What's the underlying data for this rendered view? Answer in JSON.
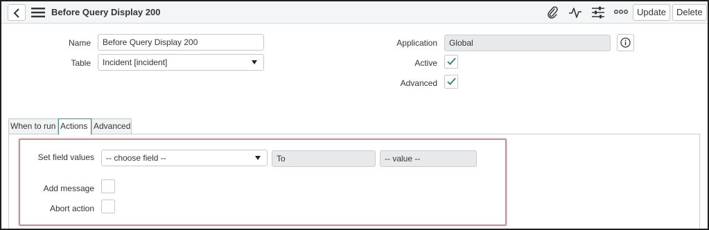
{
  "header": {
    "title": "Before Query Display 200",
    "update_label": "Update",
    "delete_label": "Delete",
    "icons": [
      "back-icon",
      "hamburger-menu-icon",
      "paperclip-icon",
      "activity-icon",
      "settings-sliders-icon",
      "more-options-icon"
    ]
  },
  "form": {
    "name_label": "Name",
    "name_value": "Before Query Display 200",
    "table_label": "Table",
    "table_value": "Incident [incident]",
    "application_label": "Application",
    "application_value": "Global",
    "active_label": "Active",
    "active_checked": true,
    "advanced_label": "Advanced",
    "advanced_checked": true
  },
  "tabs": [
    {
      "label": "When to run",
      "active": false
    },
    {
      "label": "Actions",
      "active": true
    },
    {
      "label": "Advanced",
      "active": false
    }
  ],
  "actions": {
    "set_field_values_label": "Set field values",
    "choose_field_value": "-- choose field --",
    "to_value": "To",
    "value_placeholder": "-- value --",
    "add_message_label": "Add message",
    "add_message_checked": false,
    "abort_action_label": "Abort action",
    "abort_action_checked": false
  },
  "colors": {
    "check_accent": "#2f7d79",
    "active_tab_border": "#4a8f8c",
    "highlight_border": "#b69499"
  }
}
